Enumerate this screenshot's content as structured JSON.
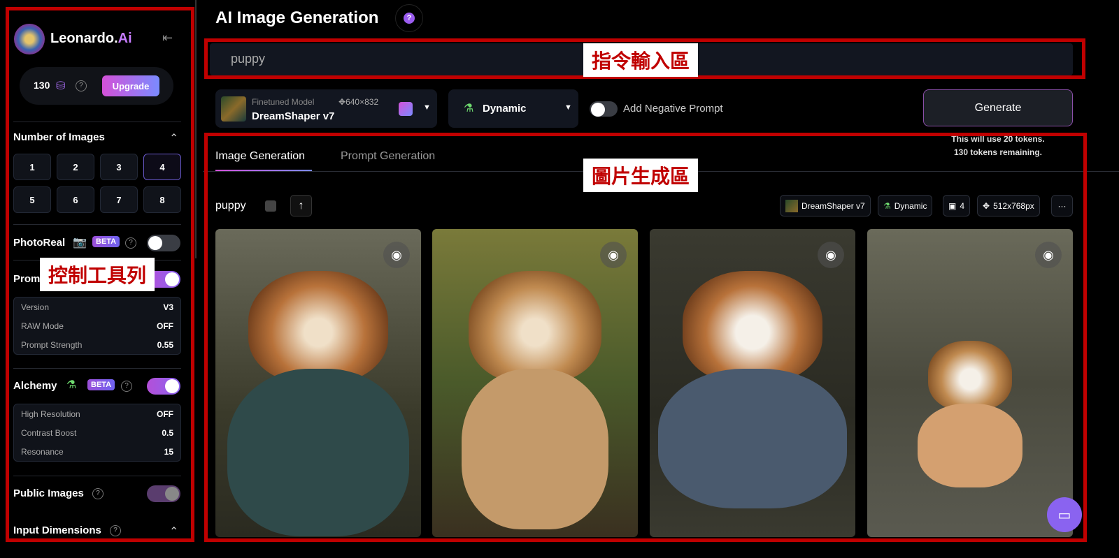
{
  "annotations": {
    "sidebar": "控制工具列",
    "prompt": "指令輸入區",
    "gallery": "圖片生成區"
  },
  "sidebar": {
    "brand": "Leonardo.",
    "brand_accent": "Ai",
    "credits": "130",
    "upgrade": "Upgrade",
    "num_images_title": "Number of Images",
    "num_options": [
      "1",
      "2",
      "3",
      "4",
      "5",
      "6",
      "7",
      "8"
    ],
    "num_selected": "4",
    "photoreal": "PhotoReal",
    "beta": "BETA",
    "photoreal_on": false,
    "prompt_magic": "Prompt Magic",
    "prompt_magic_on": true,
    "magic_settings": [
      {
        "label": "Version",
        "value": "V3"
      },
      {
        "label": "RAW Mode",
        "value": "OFF"
      },
      {
        "label": "Prompt Strength",
        "value": "0.55"
      }
    ],
    "alchemy": "Alchemy",
    "alchemy_on": true,
    "alchemy_settings": [
      {
        "label": "High Resolution",
        "value": "OFF"
      },
      {
        "label": "Contrast Boost",
        "value": "0.5"
      },
      {
        "label": "Resonance",
        "value": "15"
      }
    ],
    "public_images": "Public Images",
    "public_on": true,
    "input_dimensions": "Input Dimensions"
  },
  "header": {
    "title": "AI Image Generation",
    "help": "?"
  },
  "prompt": {
    "value": "puppy"
  },
  "toolbar": {
    "model_label": "Finetuned Model",
    "model_dims": "640×832",
    "model_name": "DreamShaper v7",
    "style": "Dynamic",
    "negative_prompt": "Add Negative Prompt",
    "negative_on": false,
    "generate": "Generate",
    "token_note_1": "This will use 20 tokens.",
    "token_note_2": "130 tokens remaining."
  },
  "tabs": [
    {
      "label": "Image Generation",
      "active": true
    },
    {
      "label": "Prompt Generation",
      "active": false
    }
  ],
  "generation": {
    "prompt": "puppy",
    "chips": {
      "model": "DreamShaper v7",
      "style": "Dynamic",
      "count": "4",
      "size": "512x768px",
      "more": "···"
    }
  },
  "colors": {
    "accent": "#c67cff",
    "annotation": "#c00000"
  }
}
